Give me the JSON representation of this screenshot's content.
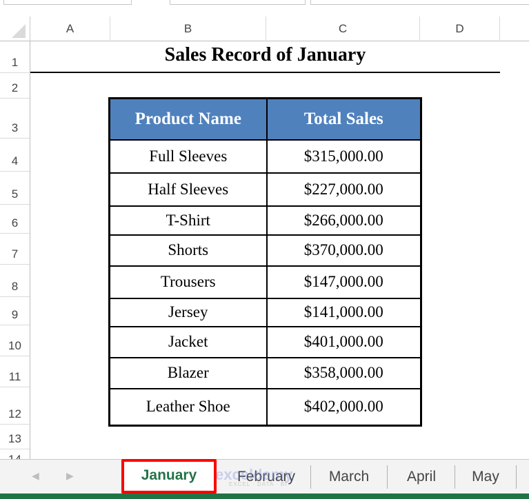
{
  "columns": [
    "A",
    "B",
    "C",
    "D"
  ],
  "rows": [
    "1",
    "2",
    "3",
    "4",
    "5",
    "6",
    "7",
    "8",
    "9",
    "10",
    "11",
    "12",
    "13",
    "14"
  ],
  "title": "Sales Record of January",
  "table": {
    "headers": [
      "Product Name",
      "Total Sales"
    ],
    "rows": [
      [
        "Full Sleeves",
        "$315,000.00"
      ],
      [
        "Half Sleeves",
        "$227,000.00"
      ],
      [
        "T-Shirt",
        "$266,000.00"
      ],
      [
        "Shorts",
        "$370,000.00"
      ],
      [
        "Trousers",
        "$147,000.00"
      ],
      [
        "Jersey",
        "$141,000.00"
      ],
      [
        "Jacket",
        "$401,000.00"
      ],
      [
        "Blazer",
        "$358,000.00"
      ],
      [
        "Leather Shoe",
        "$402,000.00"
      ]
    ]
  },
  "tabs": {
    "prev_icon": "◀",
    "next_icon": "▶",
    "items": [
      {
        "label": "January",
        "active": true
      },
      {
        "label": "February",
        "active": false
      },
      {
        "label": "March",
        "active": false
      },
      {
        "label": "April",
        "active": false
      },
      {
        "label": "May",
        "active": false
      }
    ]
  },
  "watermark": {
    "brand": "exceldemy",
    "tagline": "EXCEL · DATA · BI"
  },
  "colors": {
    "header_fill": "#4f81bd",
    "active_tab_text": "#217346",
    "highlight": "#ff0000",
    "status_bar": "#217346"
  }
}
